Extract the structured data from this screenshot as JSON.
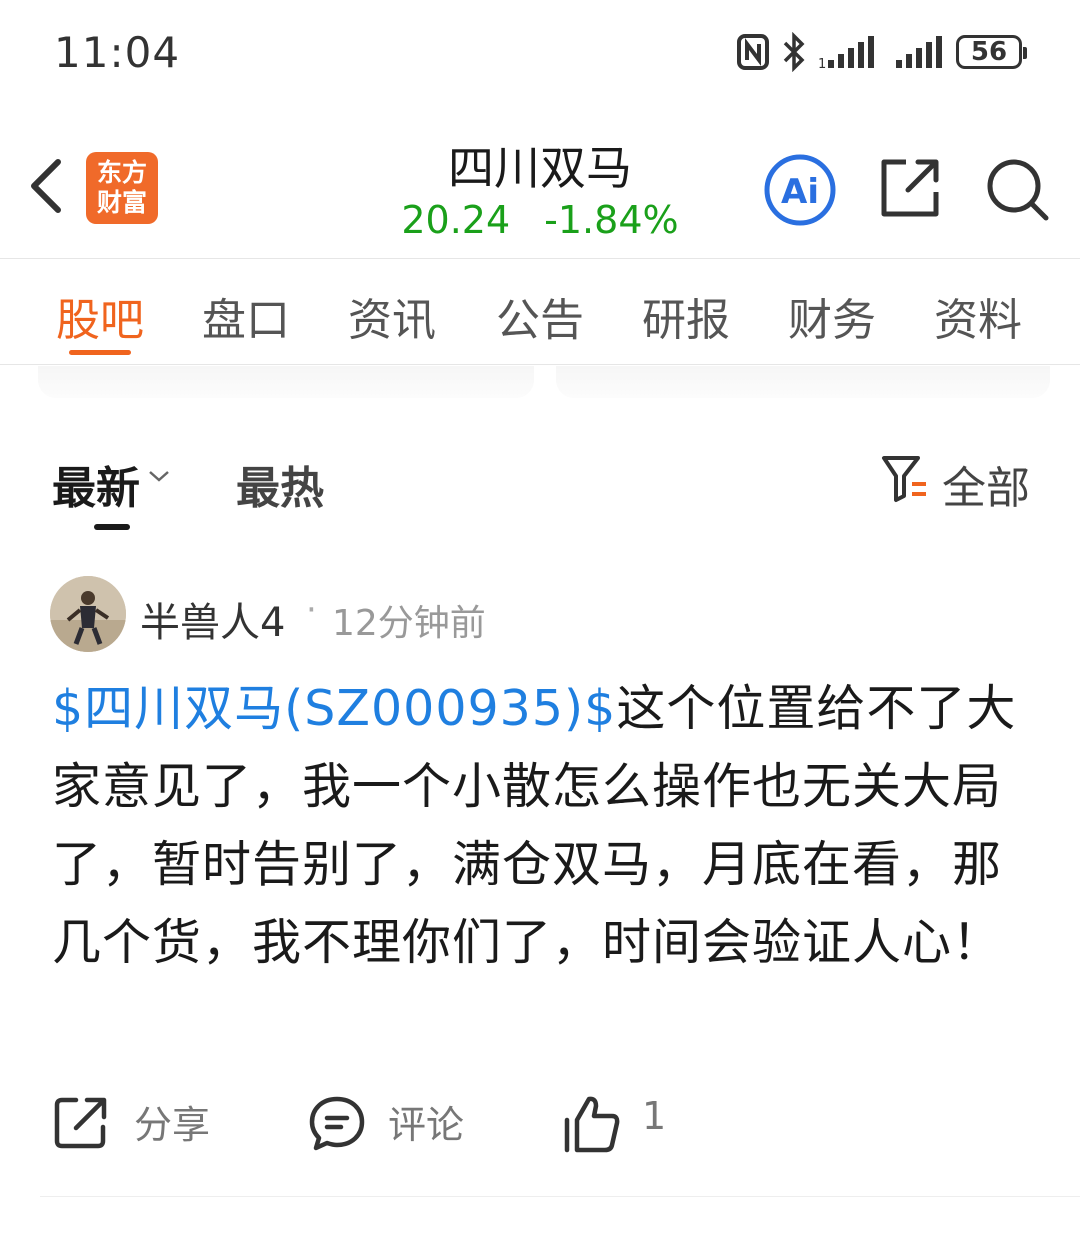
{
  "status_bar": {
    "time": "11:04",
    "battery": "56"
  },
  "header": {
    "logo_line1": "东方",
    "logo_line2": "财富",
    "title": "四川双马",
    "price": "20.24",
    "change": "-1.84%",
    "ai_label": "Ai",
    "quote_color": "#1aa01a",
    "accent_color": "#f0641e"
  },
  "tabs": [
    "股吧",
    "盘口",
    "资讯",
    "公告",
    "研报",
    "财务",
    "资料"
  ],
  "sort": {
    "newest": "最新",
    "hottest": "最热",
    "filter": "全部"
  },
  "post": {
    "username": "半兽人4",
    "separator": "·",
    "time": "12分钟前",
    "stock_tag": "$四川双马(SZ000935)$",
    "text": "这个位置给不了大家意见了，我一个小散怎么操作也无关大局了，暂时告别了，满仓双马，月底在看，那几个货，我不理你们了，时间会验证人心！",
    "actions": {
      "share": "分享",
      "comment": "评论",
      "likes": "1"
    },
    "link_color": "#1f7fe0"
  }
}
